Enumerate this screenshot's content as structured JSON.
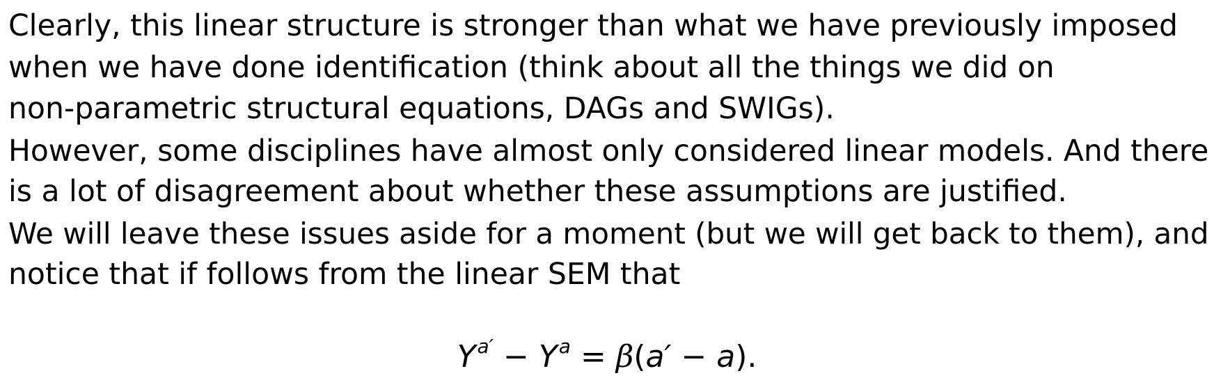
{
  "paragraphs": [
    {
      "lines": [
        "Clearly, this linear structure is stronger than what we have previously imposed",
        "when we have done identification (think about all the things we did on",
        "non-parametric structural equations, DAGs and SWIGs)."
      ]
    },
    {
      "lines": [
        "However, some disciplines have almost only considered linear models.  And there",
        "is a lot of disagreement about whether these assumptions are justified."
      ]
    },
    {
      "lines": [
        "We will leave these issues aside for a moment (but we will get back to them), and",
        "notice that if follows from the linear SEM that"
      ]
    }
  ],
  "equation": {
    "lhs_var": "Y",
    "lhs_sup": "a′",
    "minus": "−",
    "rhs_var": "Y",
    "rhs_sup": "a",
    "equals": "=",
    "beta": "β",
    "open_paren": "(",
    "a_prime": "a′",
    "inner_minus": "−",
    "a": "a",
    "close_paren": ").",
    "full_text": "Ya′ − Ya = β(a′ − a)."
  }
}
